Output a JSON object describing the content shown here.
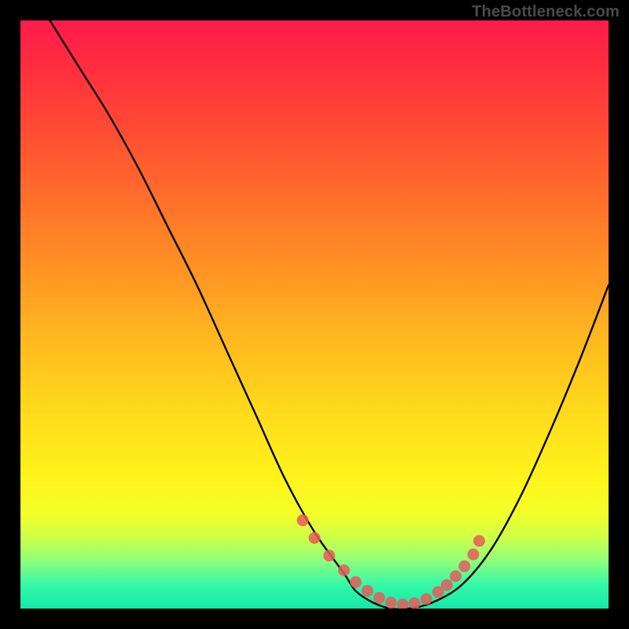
{
  "watermark": "TheBottleneck.com",
  "chart_data": {
    "type": "line",
    "title": "",
    "xlabel": "",
    "ylabel": "",
    "xlim": [
      0,
      100
    ],
    "ylim": [
      0,
      100
    ],
    "series": [
      {
        "name": "bottleneck-curve",
        "x": [
          5,
          10,
          15,
          20,
          25,
          30,
          35,
          40,
          45,
          50,
          55,
          57,
          60,
          63,
          66,
          70,
          75,
          80,
          85,
          90,
          95,
          100
        ],
        "values": [
          100,
          92,
          84,
          75,
          65,
          55,
          44,
          33,
          22,
          13,
          6,
          3,
          1,
          0,
          0,
          1,
          4,
          10,
          19,
          30,
          42,
          55
        ]
      }
    ],
    "markers": {
      "name": "highlight-dots",
      "color": "#e85a5a",
      "x": [
        48,
        50,
        52.5,
        55,
        57,
        59,
        61,
        63,
        65,
        67,
        69,
        71,
        72.5,
        74,
        75.5,
        77,
        78
      ],
      "values": [
        15,
        12,
        9,
        6.5,
        4.5,
        3,
        1.8,
        1,
        0.7,
        0.9,
        1.6,
        2.8,
        4,
        5.5,
        7.2,
        9.2,
        11.5
      ]
    },
    "gradient_stops": [
      {
        "pos": 0,
        "color": "#ff1b4a"
      },
      {
        "pos": 50,
        "color": "#ffb81f"
      },
      {
        "pos": 80,
        "color": "#fff41b"
      },
      {
        "pos": 100,
        "color": "#15e8a9"
      }
    ]
  }
}
